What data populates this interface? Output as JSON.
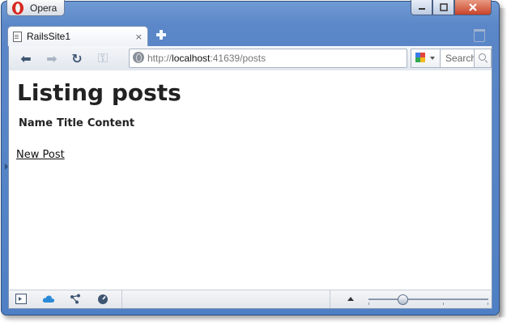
{
  "app": {
    "menu_label": "Opera"
  },
  "tab": {
    "title": "RailsSite1",
    "close_glyph": "×"
  },
  "toolbar": {
    "back_glyph": "⬅",
    "forward_glyph": "➡",
    "reload_glyph": "↻",
    "key_glyph": "⚿",
    "url_scheme": "http://",
    "url_host": "localhost",
    "url_rest": ":41639/posts",
    "search_placeholder": "Search"
  },
  "page": {
    "heading": "Listing posts",
    "columns": [
      "Name",
      "Title",
      "Content"
    ],
    "new_post_link": "New Post"
  },
  "colors": {
    "accent": "#4f7fc4",
    "panel_cloud": "#2b8ad8"
  },
  "zoom_percent": 25
}
